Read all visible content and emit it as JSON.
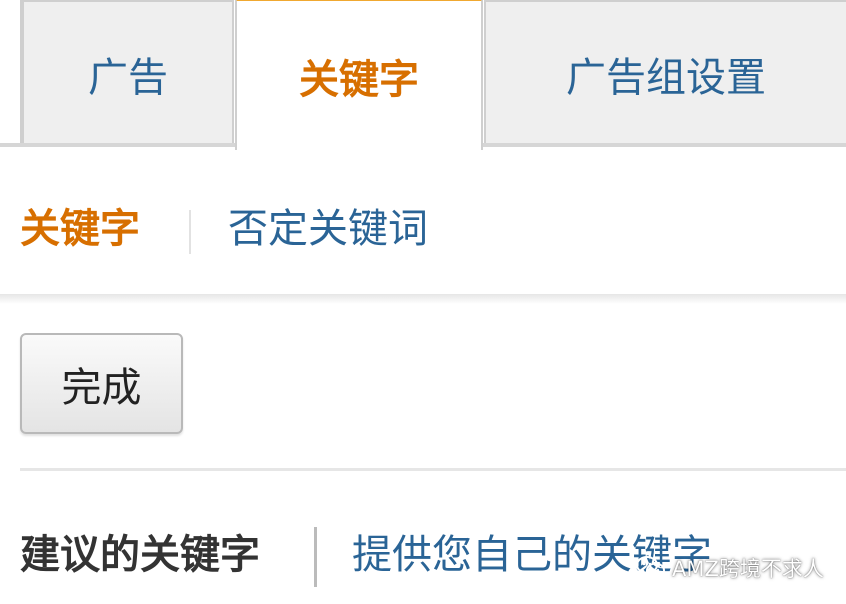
{
  "tabs": [
    {
      "label": "广告",
      "active": false
    },
    {
      "label": "关键字",
      "active": true
    },
    {
      "label": "广告组设置",
      "active": false
    }
  ],
  "subnav": {
    "active_label": "关键字",
    "negative_label": "否定关键词"
  },
  "toolbar": {
    "done_label": "完成"
  },
  "suggestions": {
    "suggested_label": "建议的关键字",
    "own_label": "提供您自己的关键字"
  },
  "watermark": {
    "text": "AMZ跨境不求人",
    "icon": "wechat-icon"
  },
  "colors": {
    "active": "#d76f00",
    "link": "#2a6496",
    "active_tab_accent": "#f0a830"
  }
}
